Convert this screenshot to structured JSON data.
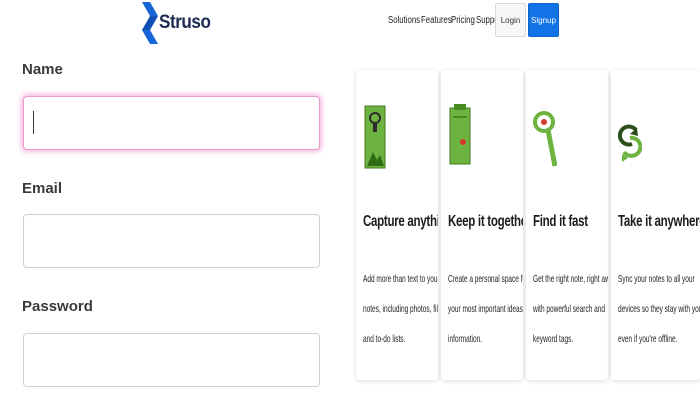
{
  "brand": {
    "name": "Struso",
    "mark_color": "#1765d8"
  },
  "nav": {
    "links": [
      "Solutions",
      "Features",
      "Pricing",
      "Support"
    ],
    "login_label": "Login",
    "signup_label": "Signup",
    "signup_color": "#1273e6"
  },
  "form": {
    "name_label": "Name",
    "name_value": "",
    "email_label": "Email",
    "email_value": "",
    "password_label": "Password",
    "password_value": "",
    "focus_color": "#e79cc9"
  },
  "features": [
    {
      "icon": "capture-icon",
      "title": "Capture anything",
      "description": "Add more than text to your notes, including photos, files and to-do lists."
    },
    {
      "icon": "notebook-icon",
      "title": "Keep it together",
      "description": "Create a personal space for all your most important ideas and information."
    },
    {
      "icon": "search-icon",
      "title": "Find it fast",
      "description": "Get the right note, right away with powerful search and keyword tags."
    },
    {
      "icon": "sync-icon",
      "title": "Take it anywhere",
      "description": "Sync your notes to all your devices so they stay with you, even if you're offline."
    }
  ],
  "accent_color": "#6db33f"
}
